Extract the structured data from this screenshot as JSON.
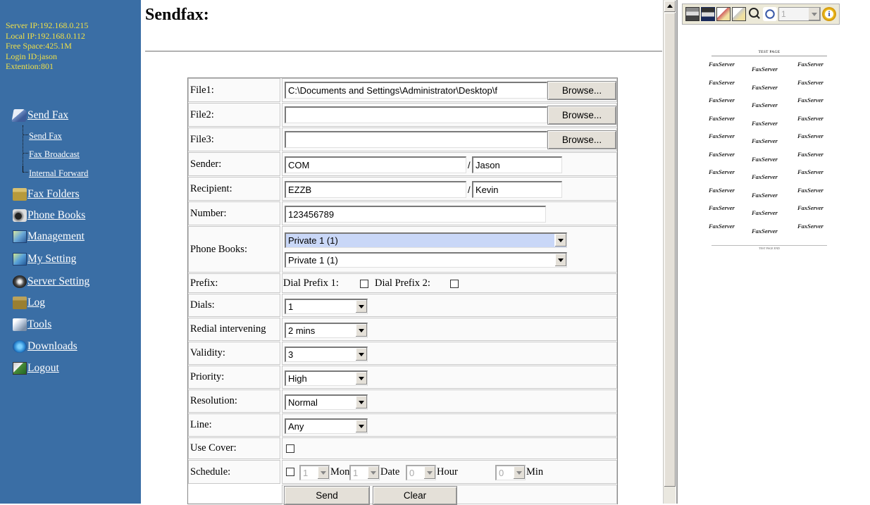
{
  "sidebar": {
    "info": [
      "Server IP:192.168.0.215",
      "Local IP:192.168.0.112",
      "Free Space:425.1M",
      "Login ID:jason",
      "Extention:801"
    ],
    "menu": [
      {
        "label": "Send Fax",
        "icon": "send-fax-icon"
      },
      {
        "label": "Fax Folders",
        "icon": "folder-icon"
      },
      {
        "label": "Phone Books",
        "icon": "phone-icon"
      },
      {
        "label": "Management",
        "icon": "management-icon"
      },
      {
        "label": "My Setting",
        "icon": "settings-icon"
      },
      {
        "label": "Server Setting",
        "icon": "server-icon"
      },
      {
        "label": "Log",
        "icon": "log-icon"
      },
      {
        "label": "Tools",
        "icon": "tools-icon"
      },
      {
        "label": "Downloads",
        "icon": "download-icon"
      },
      {
        "label": "Logout",
        "icon": "logout-icon"
      }
    ],
    "submenu": [
      "Send Fax",
      "Fax Broadcast",
      "Internal Forward"
    ]
  },
  "page": {
    "title": "Sendfax:"
  },
  "form": {
    "file1": {
      "label": "File1:",
      "value": "C:\\Documents and Settings\\Administrator\\Desktop\\f"
    },
    "file2": {
      "label": "File2:",
      "value": ""
    },
    "file3": {
      "label": "File3:",
      "value": ""
    },
    "browse_label": "Browse...",
    "sender": {
      "label": "Sender:",
      "value1": "COM",
      "value2": "Jason"
    },
    "recipient": {
      "label": "Recipient:",
      "value1": "EZZB",
      "value2": "Kevin"
    },
    "separator": "/",
    "number": {
      "label": "Number:",
      "value": "123456789"
    },
    "phone_books": {
      "label": "Phone Books:",
      "select1": "Private 1 (1)",
      "select2": "Private 1 (1)"
    },
    "prefix": {
      "label": "Prefix:",
      "dial1": "Dial Prefix 1:",
      "dial2": "Dial Prefix 2:"
    },
    "dials": {
      "label": "Dials:",
      "value": "1"
    },
    "redial": {
      "label": "Redial intervening",
      "value": "2 mins"
    },
    "validity": {
      "label": "Validity:",
      "value": "3"
    },
    "priority": {
      "label": "Priority:",
      "value": "High"
    },
    "resolution": {
      "label": "Resolution:",
      "value": "Normal"
    },
    "line": {
      "label": "Line:",
      "value": "Any"
    },
    "use_cover": {
      "label": "Use Cover:"
    },
    "schedule": {
      "label": "Schedule:",
      "mon_value": "1",
      "mon_label": "Mon",
      "date_value": "1",
      "date_label": "Date",
      "hour_value": "0",
      "hour_label": "Hour",
      "min_value": "0",
      "min_label": "Min"
    },
    "send_label": "Send",
    "clear_label": "Clear"
  },
  "viewer": {
    "page_number": "1",
    "info_glyph": "i",
    "fax_header": "TEST PAGE",
    "fax_footer": "TEST PAGE END",
    "watermark": "FaxServer"
  },
  "colors": {
    "sidebar_bg": "#3a6ea5",
    "info_text": "#f0e048",
    "highlight_select": "#c9d7f7"
  }
}
